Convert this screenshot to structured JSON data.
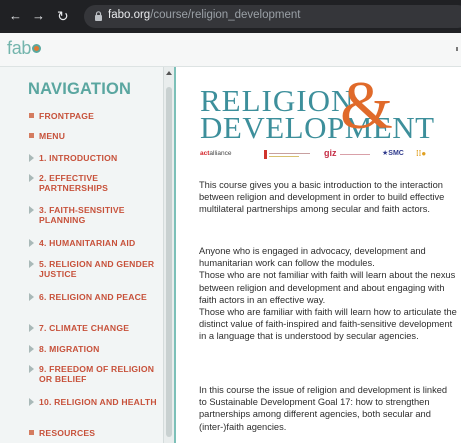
{
  "browser": {
    "back_icon": "arrow-left-icon",
    "forward_icon": "arrow-right-icon",
    "reload_icon": "reload-icon",
    "lock_icon": "lock-icon",
    "url_host": "fabo.org",
    "url_path": "/course/religion_development"
  },
  "site": {
    "logo_text": "fab",
    "logo_icon": "fabo-logo-dot"
  },
  "sidebar": {
    "title": "NAVIGATION",
    "items": [
      {
        "label": "FRONTPAGE",
        "marker": "square"
      },
      {
        "label": "MENU",
        "marker": "square"
      },
      {
        "label": "1. INTRODUCTION",
        "marker": "triangle"
      },
      {
        "label": "2. EFFECTIVE PARTNERSHIPS",
        "marker": "triangle"
      },
      {
        "label": "3. FAITH-SENSITIVE PLANNING",
        "marker": "triangle"
      },
      {
        "label": "4. HUMANITARIAN AID",
        "marker": "triangle"
      },
      {
        "label": "5. RELIGION AND GENDER JUSTICE",
        "marker": "triangle"
      },
      {
        "label": "6. RELIGION AND PEACE",
        "marker": "triangle"
      },
      {
        "label": "7. CLIMATE CHANGE",
        "marker": "triangle"
      },
      {
        "label": "8. MIGRATION",
        "marker": "triangle"
      },
      {
        "label": "9. FREEDOM OF RELIGION OR BELIEF",
        "marker": "triangle"
      },
      {
        "label": "10. RELIGION AND HEALTH",
        "marker": "triangle"
      },
      {
        "label": "RESOURCES",
        "marker": "square"
      }
    ]
  },
  "hero": {
    "line1": "RELIGION",
    "line2": "DEVELOPMENT",
    "ampersand": "&"
  },
  "partners": {
    "act_name": "act",
    "act_sub": "alliance",
    "giz": "giz",
    "smc": "SMC"
  },
  "content": {
    "paragraphs": [
      "This course gives you a basic introduction to the interaction between religion and development in order to build effective multilateral partnerships among secular and faith actors.",
      "Anyone who is engaged in advocacy, development and humanitarian work can follow the modules.\nThose who are not familiar with faith will learn about the nexus between religion and development and about engaging with faith actors in an effective way.\nThose who are familiar with faith will learn how to articulate the distinct value of faith-inspired and faith-sensitive development in a language that is understood by secular agencies.",
      "In this course the issue of religion and development is linked to Sustainable Development Goal 17: how to strengthen partnerships among different agencies, both secular and (inter-)faith agencies."
    ]
  },
  "colors": {
    "chrome_bg": "#202124",
    "teal": "#3d8f9b",
    "nav_title": "#5aa6a0",
    "nav_item": "#c7513a",
    "ampersand": "#e06a2a"
  }
}
